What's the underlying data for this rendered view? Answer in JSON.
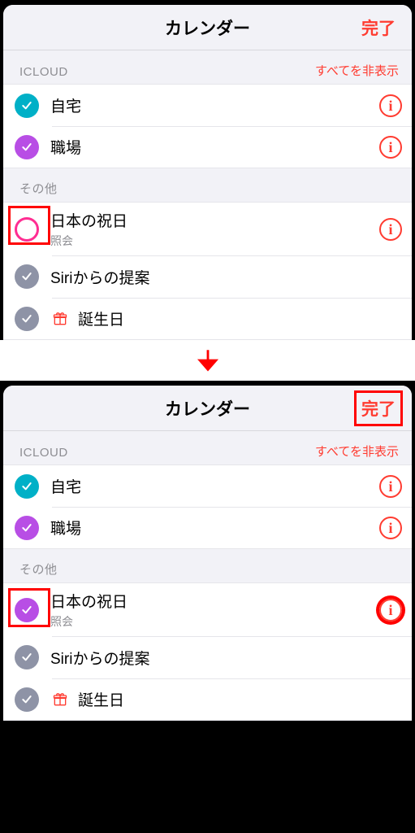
{
  "top": {
    "title": "カレンダー",
    "done": "完了",
    "sections": [
      {
        "header": "ICLOUD",
        "hideAll": "すべてを非表示",
        "items": [
          {
            "label": "自宅",
            "checkColor": "#00b0c7",
            "checked": true,
            "info": true
          },
          {
            "label": "職場",
            "checkColor": "#b84ee5",
            "checked": true,
            "info": true
          }
        ]
      },
      {
        "header": "その他",
        "items": [
          {
            "label": "日本の祝日",
            "sublabel": "照会",
            "checkColor": "#ff2d92",
            "checked": false,
            "info": true,
            "highlightCheck": true
          },
          {
            "label": "Siriからの提案",
            "checkColor": "#8e93a6",
            "checked": true,
            "info": false
          },
          {
            "label": "誕生日",
            "leadIcon": "gift",
            "checkColor": "#8e93a6",
            "checked": true,
            "info": false
          }
        ]
      }
    ]
  },
  "bottom": {
    "title": "カレンダー",
    "done": "完了",
    "highlightDone": true,
    "sections": [
      {
        "header": "ICLOUD",
        "hideAll": "すべてを非表示",
        "items": [
          {
            "label": "自宅",
            "checkColor": "#00b0c7",
            "checked": true,
            "info": true
          },
          {
            "label": "職場",
            "checkColor": "#b84ee5",
            "checked": true,
            "info": true
          }
        ]
      },
      {
        "header": "その他",
        "items": [
          {
            "label": "日本の祝日",
            "sublabel": "照会",
            "checkColor": "#b84ee5",
            "checked": true,
            "info": true,
            "highlightCheck": true,
            "highlightInfo": true
          },
          {
            "label": "Siriからの提案",
            "checkColor": "#8e93a6",
            "checked": true,
            "info": false
          },
          {
            "label": "誕生日",
            "leadIcon": "gift",
            "checkColor": "#8e93a6",
            "checked": true,
            "info": false
          }
        ]
      }
    ]
  }
}
